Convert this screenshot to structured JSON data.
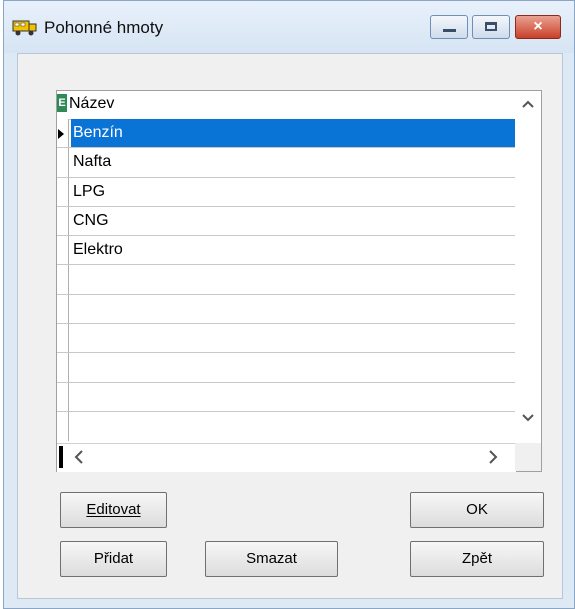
{
  "window": {
    "title": "Pohonné hmoty",
    "icon": "truck-icon",
    "controls": {
      "minimize": "minimize-icon",
      "maximize": "maximize-icon",
      "close": "×"
    }
  },
  "grid": {
    "header_indicator": "E",
    "column_header": "Název",
    "rows": [
      "Benzín",
      "Nafta",
      "LPG",
      "CNG",
      "Elektro",
      "",
      "",
      "",
      "",
      "",
      ""
    ],
    "selected_row": "Benzín",
    "scroll": {
      "up": "^",
      "down": "v",
      "left": "<",
      "right": ">"
    }
  },
  "buttons": {
    "edit": "Editovat",
    "ok": "OK",
    "add": "Přidat",
    "delete": "Smazat",
    "back": "Zpět"
  },
  "colors": {
    "selection": "#0a74d6",
    "window_bg": "#dde9f5"
  }
}
